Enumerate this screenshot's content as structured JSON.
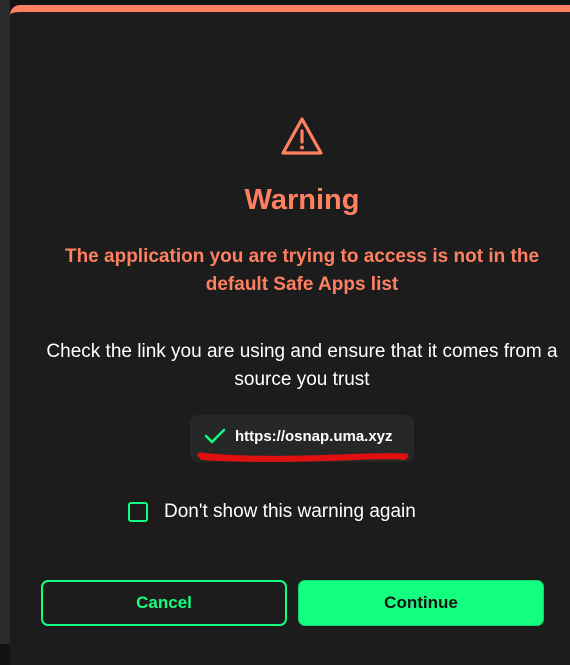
{
  "dialog": {
    "accent_color": "#ff8061",
    "title": "Warning",
    "subtitle": "The application you are trying to access is not in the default Safe Apps list",
    "body": "Check the link you are using and ensure that it comes from a source you trust",
    "url": "https://osnap.uma.xyz",
    "checkbox_label": "Don't show this warning again",
    "checkbox_checked": false,
    "cancel_label": "Cancel",
    "continue_label": "Continue",
    "primary_color": "#12ff80"
  }
}
